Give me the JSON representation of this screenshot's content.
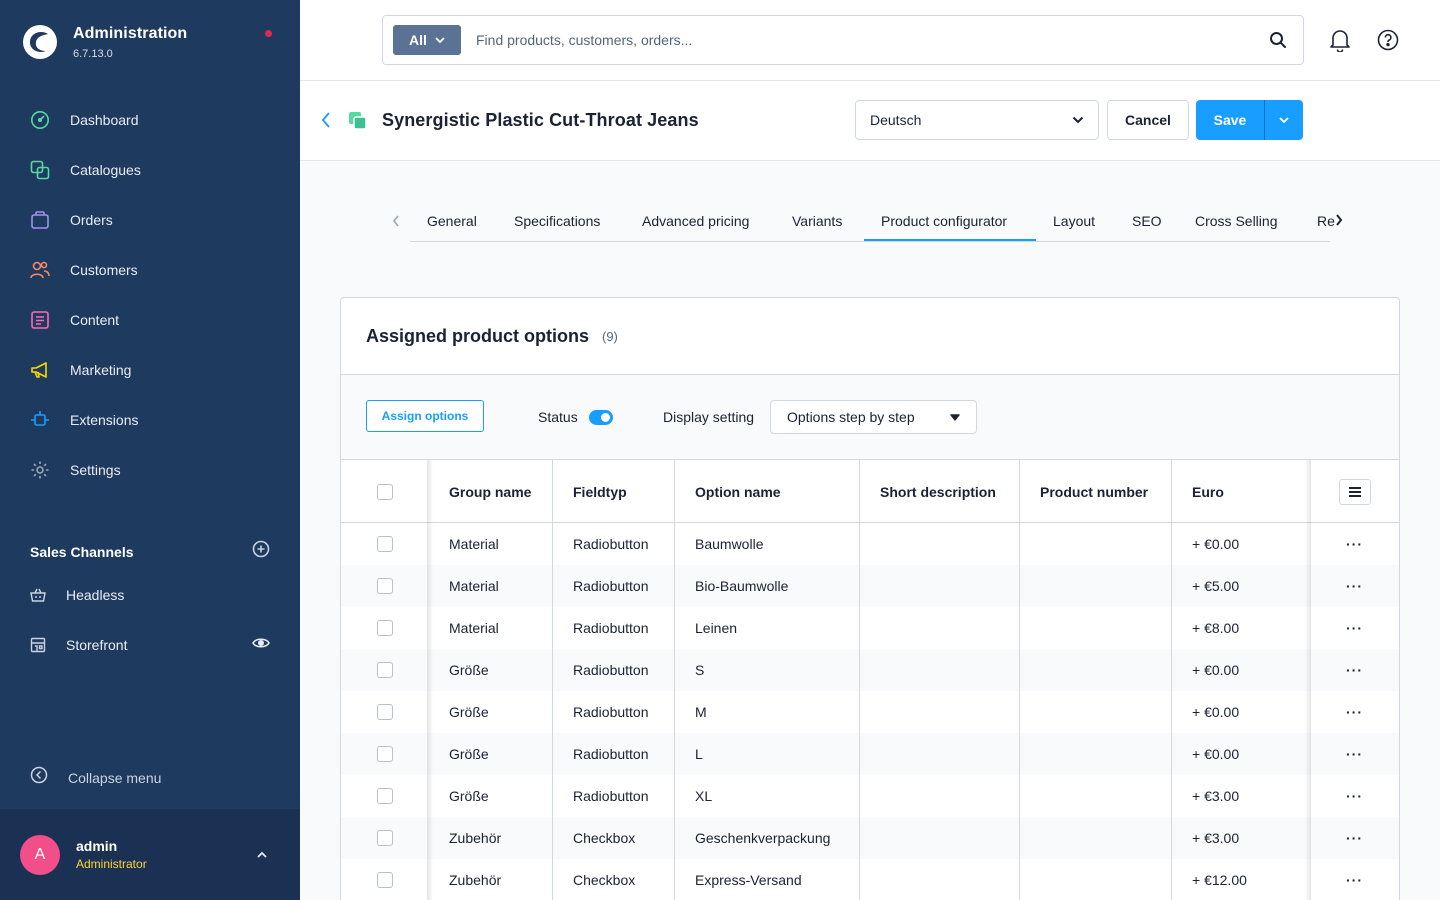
{
  "app": {
    "title": "Administration",
    "version": "6.7.13.0"
  },
  "nav": {
    "items": [
      {
        "label": "Dashboard",
        "icon": "dashboard-icon",
        "color": "#57d9a3"
      },
      {
        "label": "Catalogues",
        "icon": "catalogue-icon",
        "color": "#57d9a3"
      },
      {
        "label": "Orders",
        "icon": "orders-icon",
        "color": "#a092f0"
      },
      {
        "label": "Customers",
        "icon": "customers-icon",
        "color": "#f88962"
      },
      {
        "label": "Content",
        "icon": "content-icon",
        "color": "#ff68b4"
      },
      {
        "label": "Marketing",
        "icon": "marketing-icon",
        "color": "#ffd700"
      },
      {
        "label": "Extensions",
        "icon": "extensions-icon",
        "color": "#189eff"
      },
      {
        "label": "Settings",
        "icon": "settings-icon",
        "color": "#9aa8b5"
      }
    ]
  },
  "sales_channels": {
    "title": "Sales Channels",
    "items": [
      {
        "label": "Headless",
        "icon": "basket-icon"
      },
      {
        "label": "Storefront",
        "icon": "storefront-icon"
      }
    ]
  },
  "sidebar_footer": {
    "collapse_label": "Collapse menu"
  },
  "user": {
    "initial": "A",
    "name": "admin",
    "role": "Administrator"
  },
  "search": {
    "type_label": "All",
    "placeholder": "Find products, customers, orders..."
  },
  "page": {
    "title": "Synergistic Plastic Cut-Throat Jeans",
    "language": "Deutsch",
    "cancel_label": "Cancel",
    "save_label": "Save"
  },
  "tabs": {
    "items": [
      {
        "label": "General"
      },
      {
        "label": "Specifications"
      },
      {
        "label": "Advanced pricing"
      },
      {
        "label": "Variants"
      },
      {
        "label": "Product configurator"
      },
      {
        "label": "Layout"
      },
      {
        "label": "SEO"
      },
      {
        "label": "Cross Selling"
      },
      {
        "label": "Re"
      }
    ],
    "active": "Product configurator"
  },
  "card": {
    "title": "Assigned product options",
    "count": "(9)",
    "assign_label": "Assign options",
    "status_label": "Status",
    "status_on": true,
    "display_label": "Display setting",
    "display_value": "Options step by step"
  },
  "table": {
    "columns": [
      "Group name",
      "Fieldtyp",
      "Option name",
      "Short description",
      "Product number",
      "Euro"
    ],
    "rows": [
      {
        "group": "Material",
        "type": "Radiobutton",
        "option": "Baumwolle",
        "short": "",
        "number": "",
        "price": "+ €0.00"
      },
      {
        "group": "Material",
        "type": "Radiobutton",
        "option": "Bio-Baumwolle",
        "short": "",
        "number": "",
        "price": "+ €5.00"
      },
      {
        "group": "Material",
        "type": "Radiobutton",
        "option": "Leinen",
        "short": "",
        "number": "",
        "price": "+ €8.00"
      },
      {
        "group": "Größe",
        "type": "Radiobutton",
        "option": "S",
        "short": "",
        "number": "",
        "price": "+ €0.00"
      },
      {
        "group": "Größe",
        "type": "Radiobutton",
        "option": "M",
        "short": "",
        "number": "",
        "price": "+ €0.00"
      },
      {
        "group": "Größe",
        "type": "Radiobutton",
        "option": "L",
        "short": "",
        "number": "",
        "price": "+ €0.00"
      },
      {
        "group": "Größe",
        "type": "Radiobutton",
        "option": "XL",
        "short": "",
        "number": "",
        "price": "+ €3.00"
      },
      {
        "group": "Zubehör",
        "type": "Checkbox",
        "option": "Geschenkverpackung",
        "short": "",
        "number": "",
        "price": "+ €3.00"
      },
      {
        "group": "Zubehör",
        "type": "Checkbox",
        "option": "Express-Versand",
        "short": "",
        "number": "",
        "price": "+ €12.00"
      }
    ],
    "row_action": "···"
  },
  "colors": {
    "sidebar": "#1f3a5f",
    "accent": "#189eff",
    "avatar": "#f24e8a",
    "role": "#ffd43b",
    "notify": "#de294c"
  }
}
